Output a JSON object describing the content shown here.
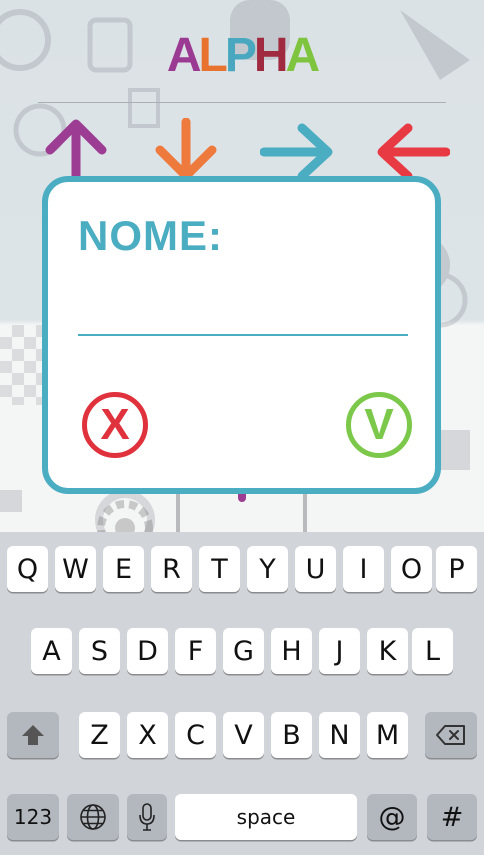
{
  "app": {
    "logo_letters": [
      {
        "char": "A",
        "color": "#9b3a93"
      },
      {
        "char": "L",
        "color": "#e8732f"
      },
      {
        "char": "P",
        "color": "#49a8c0"
      },
      {
        "char": "H",
        "color": "#a02a40"
      },
      {
        "char": "A",
        "color": "#7fc43f"
      }
    ],
    "arrows": [
      {
        "name": "up",
        "color": "#9c3c92"
      },
      {
        "name": "down",
        "color": "#ee7a3e"
      },
      {
        "name": "right",
        "color": "#4aadc2"
      },
      {
        "name": "left",
        "color": "#e83a43"
      }
    ]
  },
  "dialog": {
    "title": "NOME:",
    "input_value": "",
    "input_placeholder": "",
    "cancel_label": "X",
    "confirm_label": "V",
    "border_color": "#4aadc2"
  },
  "keyboard": {
    "row1": [
      "Q",
      "W",
      "E",
      "R",
      "T",
      "Y",
      "U",
      "I",
      "O",
      "P"
    ],
    "row2": [
      "A",
      "S",
      "D",
      "F",
      "G",
      "H",
      "J",
      "K",
      "L"
    ],
    "row3": [
      "Z",
      "X",
      "C",
      "V",
      "B",
      "N",
      "M"
    ],
    "numbers_label": "123",
    "space_label": "space",
    "at_label": "@",
    "hash_label": "#",
    "shift_icon": "shift-icon",
    "delete_icon": "backspace-icon",
    "globe_icon": "globe-icon",
    "mic_icon": "microphone-icon"
  }
}
